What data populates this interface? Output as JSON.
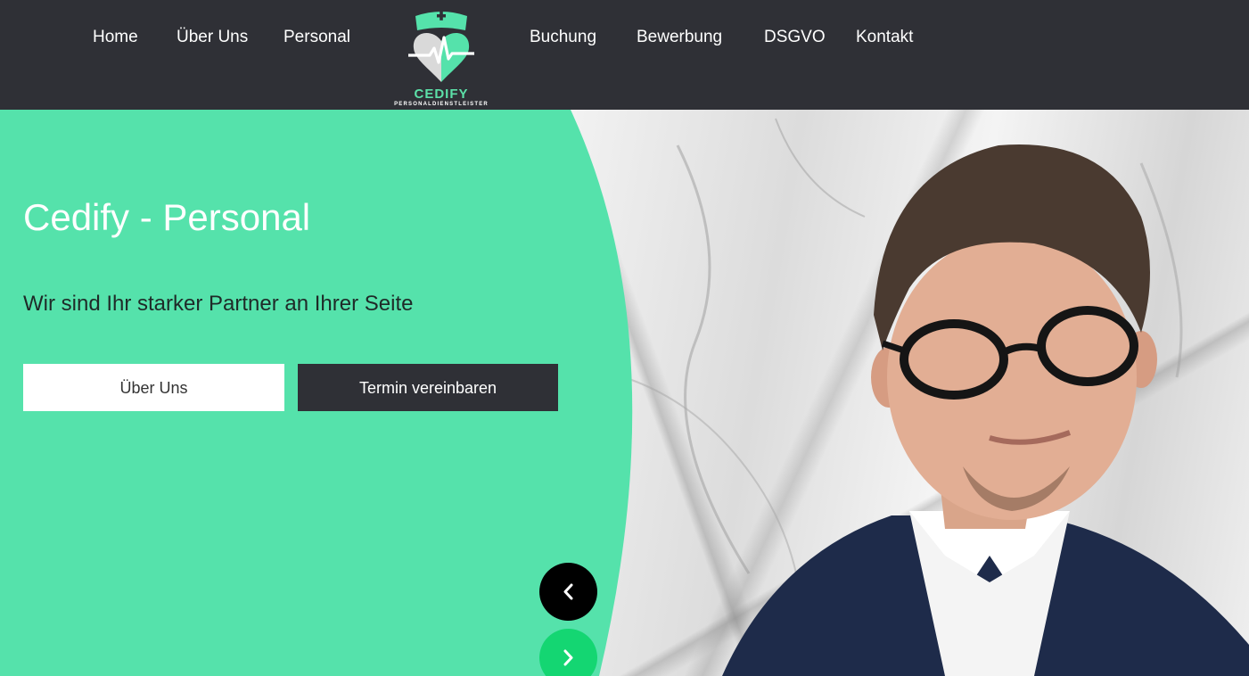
{
  "nav": {
    "left_items": [
      {
        "label": "Home"
      },
      {
        "label": "Über Uns"
      },
      {
        "label": "Personal"
      }
    ],
    "right_items": [
      {
        "label": "Buchung"
      },
      {
        "label": "Bewerbung"
      },
      {
        "label": "DSGVO"
      },
      {
        "label": "Kontakt"
      }
    ]
  },
  "logo": {
    "name": "CEDIFY",
    "tagline": "PERSONALDIENSTLEISTER",
    "icon": "nurse-heart-logo"
  },
  "hero": {
    "title": "Cedify - Personal",
    "subtitle": "Wir sind Ihr starker Partner an Ihrer Seite",
    "primary_button": "Über Uns",
    "secondary_button": "Termin vereinbaren",
    "prev_icon": "chevron-left-icon",
    "next_icon": "chevron-right-icon"
  },
  "colors": {
    "header_bg": "#2f3036",
    "accent_green": "#55e2ab",
    "next_button": "#14d672",
    "prev_button": "#000000"
  }
}
